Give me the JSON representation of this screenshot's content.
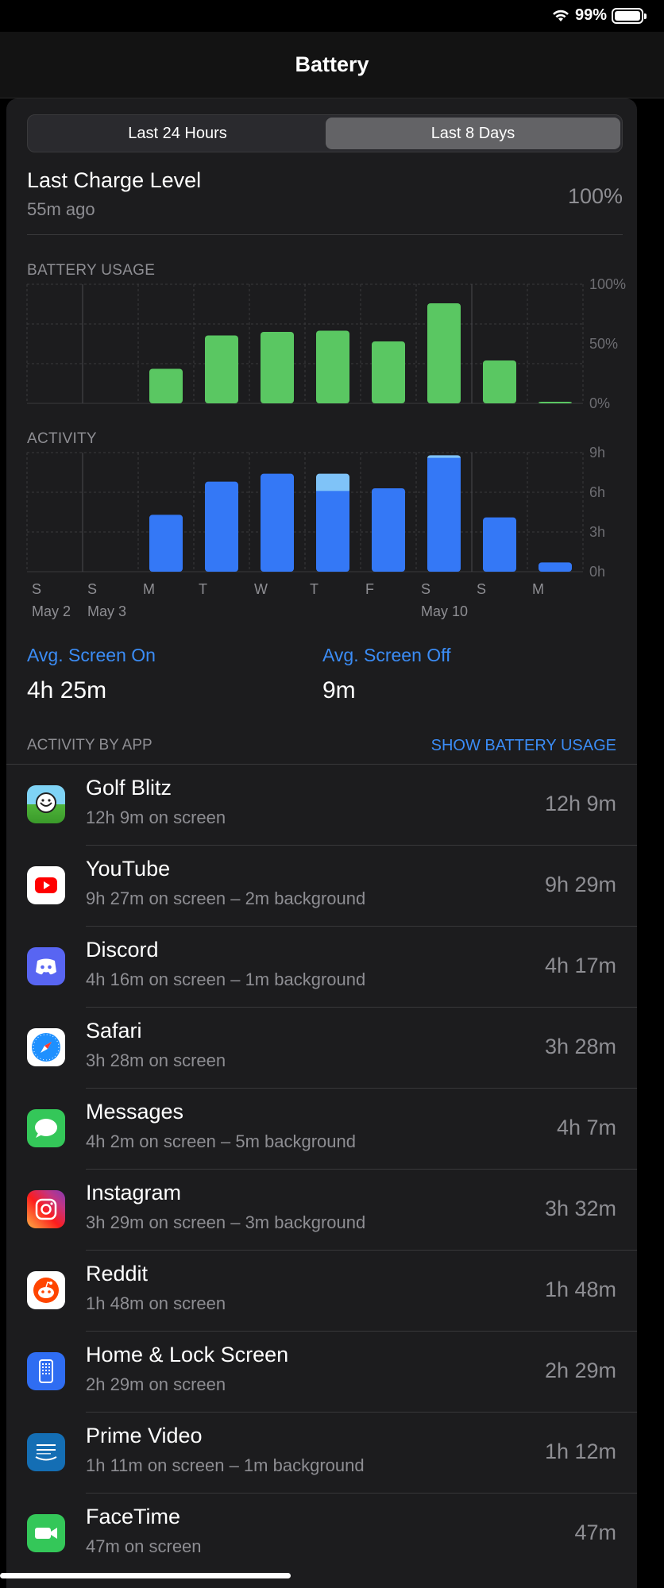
{
  "status_bar": {
    "battery_percent": "99%"
  },
  "nav": {
    "title": "Battery"
  },
  "segments": {
    "left": "Last 24 Hours",
    "right": "Last 8 Days",
    "selected": "right"
  },
  "last_charge": {
    "title": "Last Charge Level",
    "subtitle": "55m ago",
    "value": "100%"
  },
  "battery_usage_label": "BATTERY USAGE",
  "activity_label": "ACTIVITY",
  "chart_data": [
    {
      "type": "bar",
      "title": "BATTERY USAGE",
      "categories": [
        "S",
        "S",
        "M",
        "T",
        "W",
        "T",
        "F",
        "S",
        "S",
        "M"
      ],
      "values": [
        0,
        0,
        29,
        57,
        60,
        61,
        52,
        84,
        36,
        1
      ],
      "ylim": [
        0,
        100
      ],
      "yticks": [
        "100%",
        "50%",
        "0%"
      ],
      "color": "#5ac762"
    },
    {
      "type": "bar",
      "title": "ACTIVITY",
      "categories": [
        "S",
        "S",
        "M",
        "T",
        "W",
        "T",
        "F",
        "S",
        "S",
        "M"
      ],
      "series": [
        {
          "name": "Screen On",
          "values": [
            0,
            0,
            4.3,
            6.8,
            7.4,
            6.1,
            6.3,
            8.6,
            4.1,
            0.7
          ],
          "color": "#3478f6"
        },
        {
          "name": "Screen Off",
          "values": [
            0,
            0,
            0,
            0,
            0,
            1.3,
            0,
            0.2,
            0,
            0
          ],
          "color": "#7fc3f8"
        }
      ],
      "ylim": [
        0,
        9
      ],
      "yticks": [
        "9h",
        "6h",
        "3h",
        "0h"
      ],
      "date_labels": [
        "May 2",
        "May 3",
        "May 10"
      ]
    }
  ],
  "averages": {
    "on_label": "Avg. Screen On",
    "on_value": "4h 25m",
    "off_label": "Avg. Screen Off",
    "off_value": "9m"
  },
  "activity_by_app": {
    "label": "ACTIVITY BY APP",
    "action": "SHOW BATTERY USAGE",
    "apps": [
      {
        "name": "Golf Blitz",
        "detail": "12h 9m on screen",
        "time": "12h 9m",
        "icon": "golf-blitz-icon"
      },
      {
        "name": "YouTube",
        "detail": "9h 27m on screen – 2m background",
        "time": "9h 29m",
        "icon": "youtube-icon"
      },
      {
        "name": "Discord",
        "detail": "4h 16m on screen – 1m background",
        "time": "4h 17m",
        "icon": "discord-icon"
      },
      {
        "name": "Safari",
        "detail": "3h 28m on screen",
        "time": "3h 28m",
        "icon": "safari-icon"
      },
      {
        "name": "Messages",
        "detail": "4h 2m on screen – 5m background",
        "time": "4h 7m",
        "icon": "messages-icon"
      },
      {
        "name": "Instagram",
        "detail": "3h 29m on screen – 3m background",
        "time": "3h 32m",
        "icon": "instagram-icon"
      },
      {
        "name": "Reddit",
        "detail": "1h 48m on screen",
        "time": "1h 48m",
        "icon": "reddit-icon"
      },
      {
        "name": "Home & Lock Screen",
        "detail": "2h 29m on screen",
        "time": "2h 29m",
        "icon": "home-lock-screen-icon"
      },
      {
        "name": "Prime Video",
        "detail": "1h 11m on screen – 1m background",
        "time": "1h 12m",
        "icon": "prime-video-icon"
      },
      {
        "name": "FaceTime",
        "detail": "47m on screen",
        "time": "47m",
        "icon": "facetime-icon"
      }
    ]
  }
}
